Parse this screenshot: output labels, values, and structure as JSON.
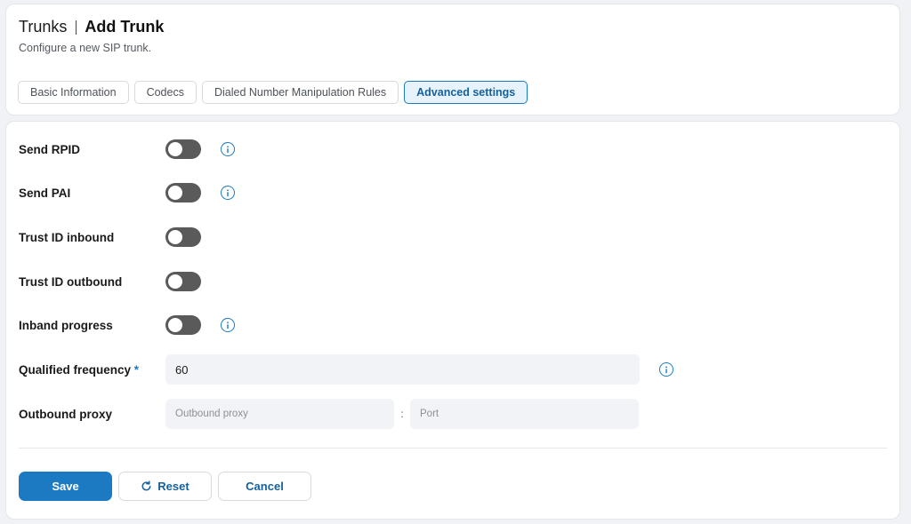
{
  "header": {
    "title": "Trunks",
    "subtitle_title": "Add Trunk",
    "description": "Configure a new SIP trunk."
  },
  "tabs": [
    {
      "label": "Basic Information",
      "active": false
    },
    {
      "label": "Codecs",
      "active": false
    },
    {
      "label": "Dialed Number Manipulation Rules",
      "active": false
    },
    {
      "label": "Advanced settings",
      "active": true
    }
  ],
  "form": {
    "send_rpid": {
      "label": "Send RPID",
      "enabled": false,
      "info_icon": "info-icon"
    },
    "send_pai": {
      "label": "Send PAI",
      "enabled": false,
      "info_icon": "info-icon"
    },
    "trust_id_inbound": {
      "label": "Trust ID inbound",
      "enabled": false
    },
    "trust_id_outbound": {
      "label": "Trust ID outbound",
      "enabled": false
    },
    "inband_progress": {
      "label": "Inband progress",
      "enabled": false,
      "info_icon": "info-icon"
    },
    "qualified_frequency": {
      "label": "Qualified frequency",
      "required_marker": "*",
      "value": "60",
      "info_icon": "info-icon"
    },
    "outbound_proxy": {
      "label": "Outbound proxy",
      "proxy_placeholder": "Outbound proxy",
      "separator": ":",
      "port_placeholder": "Port"
    }
  },
  "actions": {
    "save_label": "Save",
    "reset_label": "Reset",
    "reset_icon": "refresh-icon",
    "cancel_label": "Cancel"
  },
  "colors": {
    "primary": "#1b7ac2",
    "toggle_off": "#5a5a5a",
    "background": "#f0f2f5"
  }
}
